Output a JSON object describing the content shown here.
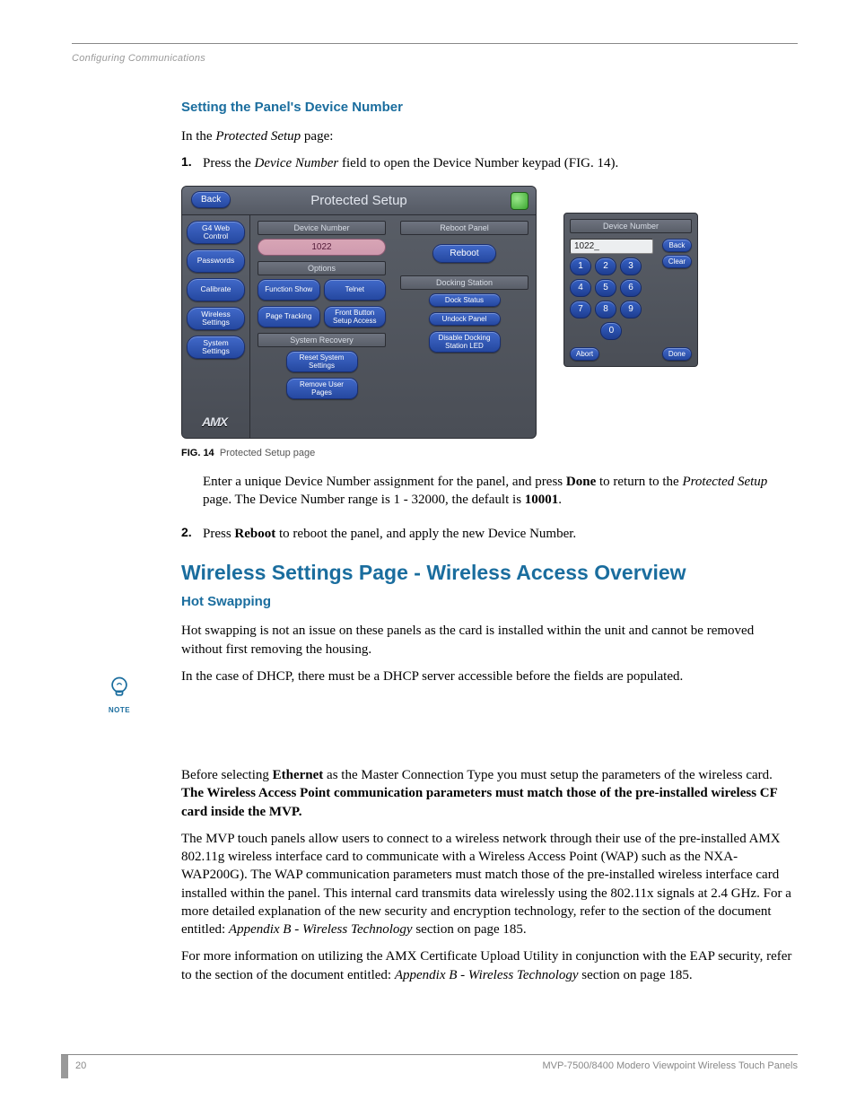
{
  "running_head": "Configuring Communications",
  "section1": {
    "title": "Setting the Panel's Device Number",
    "intro_pre": "In the ",
    "intro_em": "Protected Setup",
    "intro_post": " page:",
    "step1_num": "1.",
    "step1_pre": "Press the ",
    "step1_em": "Device Number",
    "step1_post": " field to open the Device Number keypad (FIG. 14).",
    "step1b_a": "Enter a unique Device Number assignment for the panel",
    "step1b_comma": ",",
    "step1b_b": " and press ",
    "step1b_done": "Done",
    "step1b_c": " to return to the ",
    "step1b_em": "Protected Setup",
    "step1b_d": " page. The Device Number range is 1 - 32000, the default is ",
    "step1b_default": "10001",
    "step1b_e": ".",
    "step2_num": "2.",
    "step2_pre": "Press ",
    "step2_bold": "Reboot",
    "step2_post": " to reboot the panel, and apply the new Device Number."
  },
  "fig": {
    "label": "FIG. 14",
    "caption": "Protected Setup page"
  },
  "shot": {
    "title": "Protected Setup",
    "back": "Back",
    "sidebar": [
      "G4 Web Control",
      "Passwords",
      "Calibrate",
      "Wireless Settings",
      "System Settings"
    ],
    "dev_num_head": "Device Number",
    "dev_num_val": "1022",
    "options_head": "Options",
    "opt1a": "Function Show",
    "opt1b": "Telnet",
    "opt2a": "Page Tracking",
    "opt2b": "Front Button Setup Access",
    "sysrec_head": "System Recovery",
    "sysrec1": "Reset System Settings",
    "sysrec2": "Remove User Pages",
    "reboot_head": "Reboot Panel",
    "reboot_btn": "Reboot",
    "dock_head": "Docking Station",
    "dock1": "Dock Status",
    "dock2": "Undock Panel",
    "dock3": "Disable Docking Station LED",
    "logo": "AMX"
  },
  "keypad": {
    "title": "Device Number",
    "value": "1022_",
    "back": "Back",
    "clear": "Clear",
    "keys": [
      "1",
      "2",
      "3",
      "4",
      "5",
      "6",
      "7",
      "8",
      "9",
      "0"
    ],
    "abort": "Abort",
    "done": "Done"
  },
  "section2": {
    "title": "Wireless Settings Page - Wireless Access Overview",
    "sub": "Hot Swapping",
    "p1": "Hot swapping is not an issue on these panels as the card is installed within the unit and cannot be removed without first removing the housing.",
    "p2": "In the case of DHCP, there must be a DHCP server accessible before the fields are populated.",
    "p3_a": "Before selecting ",
    "p3_eth": "Ethernet",
    "p3_b": " as the Master Connection Type you must setup the parameters of the wireless card. ",
    "p3_bold": "The Wireless Access Point communication parameters must match those of the pre-installed wireless CF card inside the MVP.",
    "p4_a": "The MVP touch panels allow users to connect to a wireless network through their use of the pre-installed AMX 802.11g wireless interface card to communicate with a Wireless Access Point (WAP) such as the NXA-WAP200G). The WAP communication parameters must match those of the pre-installed wireless interface card installed within the panel. This internal card transmits data wirelessly using the 802.11x signals at 2.4 GHz. For a more detailed explanation of the new security and encryption technology, refer to the section of the document entitled: ",
    "p4_em": "Appendix B - Wireless Technology",
    "p4_b": " section on page 185.",
    "p5_a": "For more information on utilizing the AMX Certificate Upload Utility in conjunction with the EAP security, refer to the section of the document entitled: ",
    "p5_em": "Appendix B - Wireless Technology",
    "p5_b": " section on page 185."
  },
  "note_label": "NOTE",
  "footer": {
    "page": "20",
    "title": "MVP-7500/8400 Modero Viewpoint Wireless Touch Panels"
  }
}
